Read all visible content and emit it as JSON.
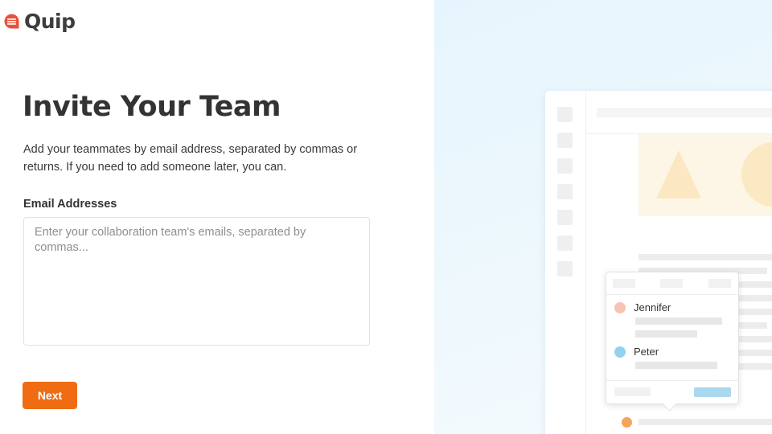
{
  "app": {
    "name": "Quip"
  },
  "invite": {
    "title": "Invite Your Team",
    "description": "Add your teammates by email address, separated by commas or returns. If you need to add someone later, you can.",
    "email_label": "Email Addresses",
    "email_placeholder": "Enter your collaboration team's emails, separated by commas...",
    "email_value": "",
    "next_label": "Next"
  },
  "illustration": {
    "people": [
      {
        "name": "Jennifer",
        "color": "#f7c3b3"
      },
      {
        "name": "Peter",
        "color": "#93d2ec"
      }
    ],
    "comment_dot_color": "#f5a55a"
  },
  "colors": {
    "accent": "#f06c13",
    "logo": "#e8513a"
  }
}
